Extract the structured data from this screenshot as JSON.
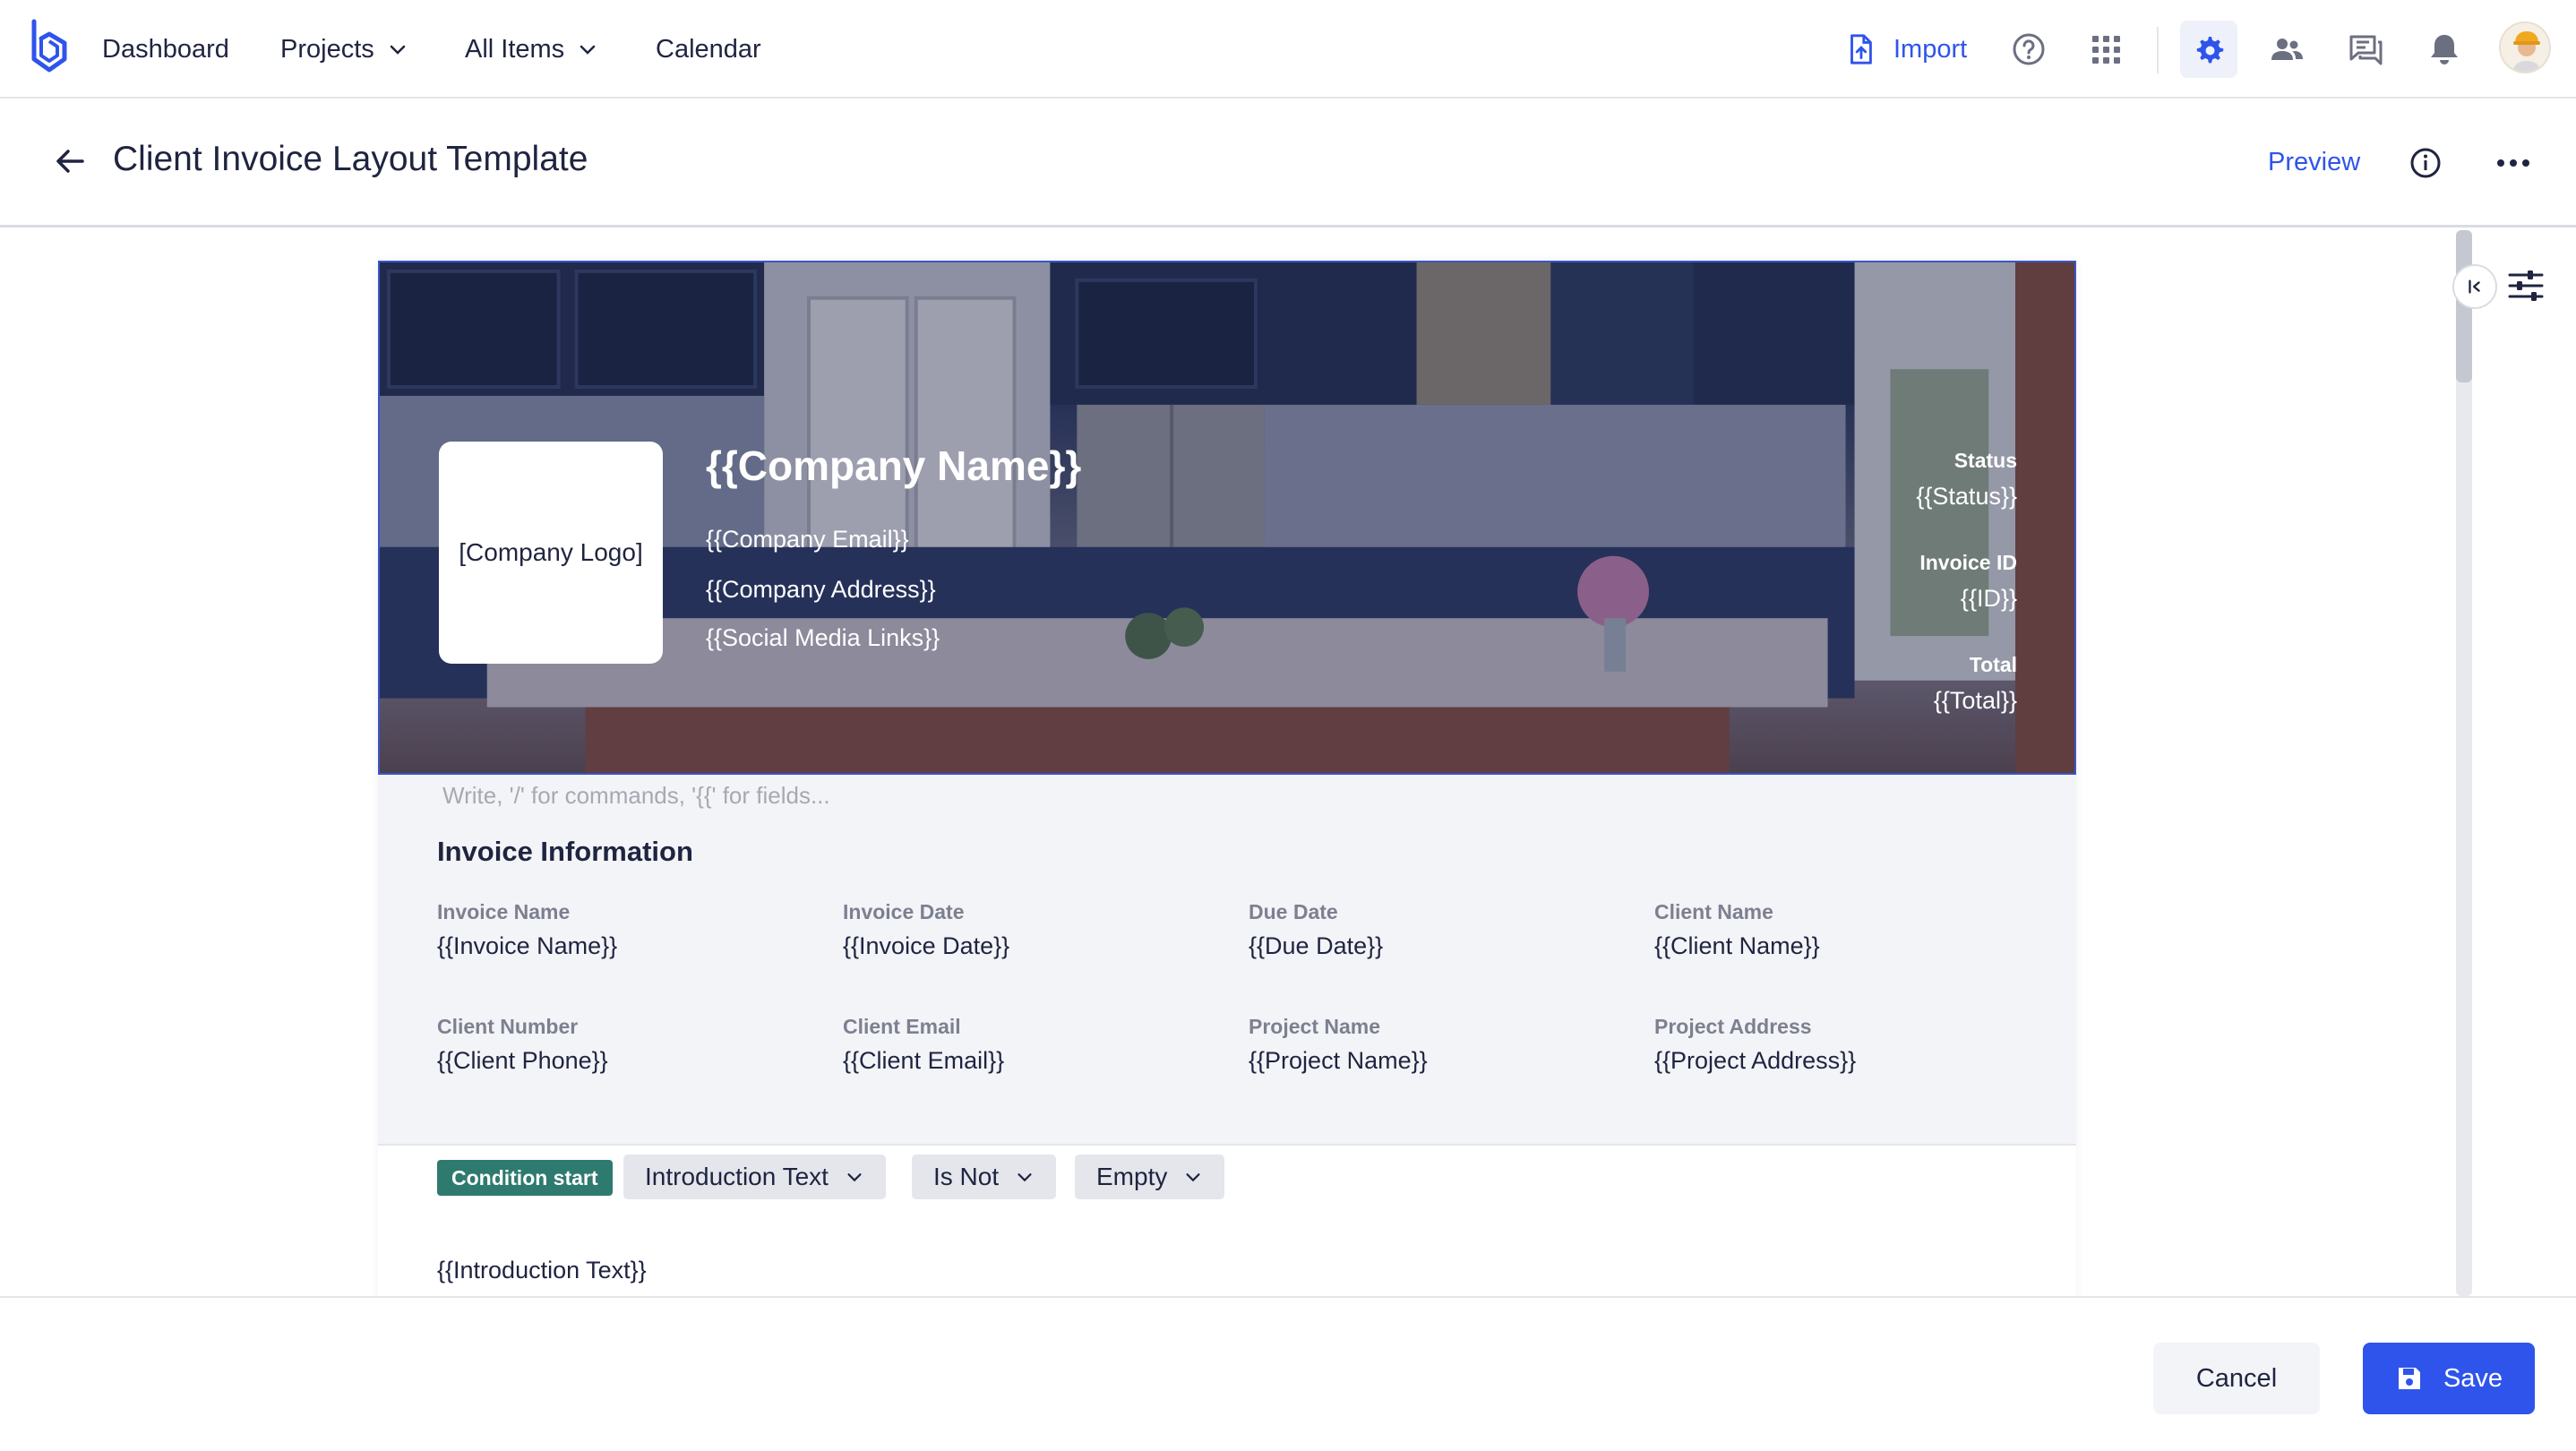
{
  "nav": {
    "items": [
      {
        "label": "Dashboard"
      },
      {
        "label": "Projects"
      },
      {
        "label": "All Items"
      },
      {
        "label": "Calendar"
      }
    ],
    "import_label": "Import",
    "icons": [
      "help-icon",
      "apps-grid-icon",
      "settings-gear-icon",
      "users-icon",
      "messages-icon",
      "notifications-bell-icon"
    ],
    "accent_color": "#2f54eb"
  },
  "header": {
    "title": "Client Invoice Layout Template",
    "preview_label": "Preview"
  },
  "template": {
    "logo_placeholder": "[Company Logo]",
    "company_name": "{{Company Name}}",
    "company_email": "{{Company Email}}",
    "company_address": "{{Company Address}}",
    "social_links": "{{Social Media Links}}",
    "meta": [
      {
        "label": "Status",
        "value": "{{Status}}"
      },
      {
        "label": "Invoice ID",
        "value": "{{ID}}"
      },
      {
        "label": "Total",
        "value": "{{Total}}"
      }
    ],
    "editor_placeholder": "Write, '/' for commands, '{{' for fields...",
    "section_title": "Invoice Information",
    "fields": [
      {
        "label": "Invoice Name",
        "value": "{{Invoice Name}}"
      },
      {
        "label": "Invoice Date",
        "value": "{{Invoice Date}}"
      },
      {
        "label": "Due Date",
        "value": "{{Due Date}}"
      },
      {
        "label": "Client Name",
        "value": "{{Client Name}}"
      },
      {
        "label": "Client Number",
        "value": "{{Client Phone}}"
      },
      {
        "label": "Client Email",
        "value": "{{Client Email}}"
      },
      {
        "label": "Project Name",
        "value": "{{Project Name}}"
      },
      {
        "label": "Project Address",
        "value": "{{Project Address}}"
      }
    ],
    "condition": {
      "badge": "Condition start",
      "field": "Introduction Text",
      "operator": "Is Not",
      "value": "Empty"
    },
    "intro_text": "{{Introduction Text}}"
  },
  "footer": {
    "cancel_label": "Cancel",
    "save_label": "Save"
  }
}
